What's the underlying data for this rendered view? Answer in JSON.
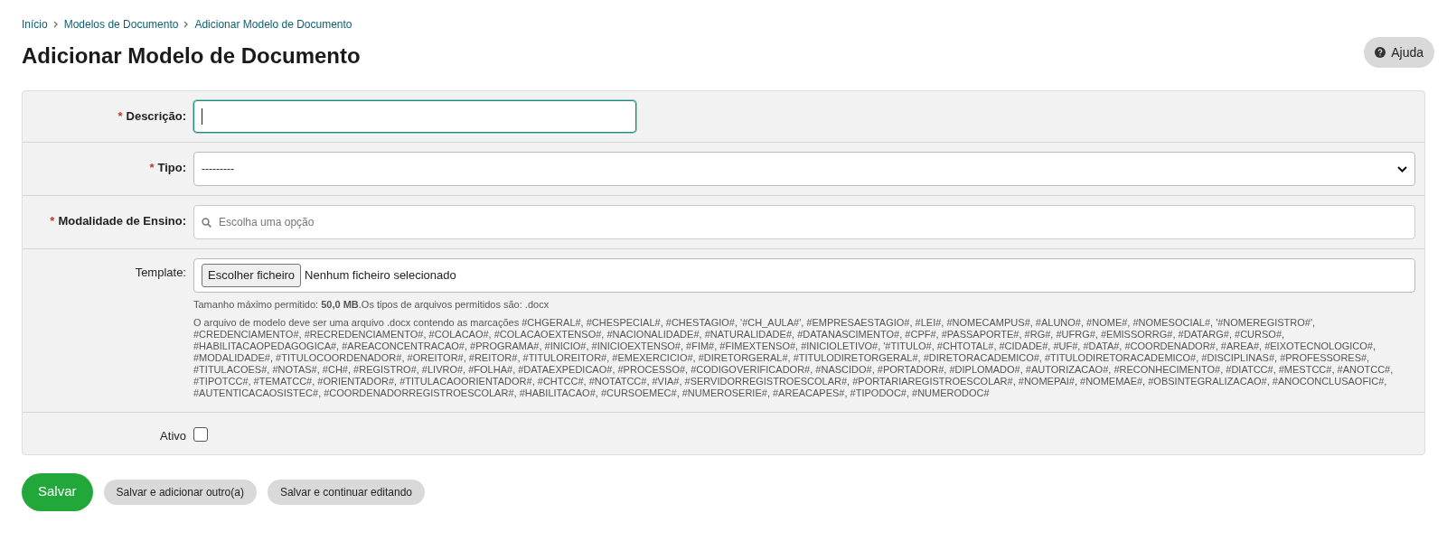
{
  "breadcrumbs": [
    {
      "label": "Início"
    },
    {
      "label": "Modelos de Documento"
    },
    {
      "label": "Adicionar Modelo de Documento"
    }
  ],
  "title": "Adicionar Modelo de Documento",
  "help_button": {
    "label": "Ajuda"
  },
  "fields": [
    {
      "kind": "text",
      "label": "Descrição:",
      "marker": "*",
      "focused": true
    },
    {
      "kind": "select",
      "label": "Tipo:",
      "marker": "*",
      "value": "---------"
    },
    {
      "kind": "autocomplete",
      "label": "Modalidade de Ensino:",
      "marker": "*",
      "placeholder": "Escolha uma opção"
    },
    {
      "kind": "file",
      "label": "Template:",
      "button": "Escolher ficheiro",
      "status": "Nenhum ficheiro selecionado",
      "help": [
        "Tamanho máximo permitido: **50,0 MB**.Os tipos de arquivos permitidos são: .docx",
        "O arquivo de modelo deve ser uma arquivo .docx contendo as marcações #CHGERAL#, #CHESPECIAL#, #CHESTAGIO#, '#CH_AULA#', #EMPRESAESTAGIO#, #LEI#, #NOMECAMPUS#, #ALUNO#, #NOME#, #NOMESOCIAL#, '#NOMEREGISTRO#', #CREDENCIAMENTO#, #RECREDENCIAMENTO#, #COLACAO#, #COLACAOEXTENSO#, #NACIONALIDADE#, #NATURALIDADE#, #DATANASCIMENTO#, #CPF#, #PASSAPORTE#, #RG#, #UFRG#, #EMISSORRG#, #DATARG#, #CURSO#, #HABILITACAOPEDAGOGICA#, #AREACONCENTRACAO#, #PROGRAMA#, #INICIO#, #INICIOEXTENSO#, #FIM#, #FIMEXTENSO#, #INICIOLETIVO#, '#TITULO#, #CHTOTAL#, #CIDADE#, #UF#, #DATA#, #COORDENADOR#, #AREA#, #EIXOTECNOLOGICO#, #MODALIDADE#, #TITULOCOORDENADOR#, #OREITOR#, #REITOR#, #TITULOREITOR#, #EMEXERCICIO#, #DIRETORGERAL#, #TITULODIRETORGERAL#, #DIRETORACADEMICO#, #TITULODIRETORACADEMICO#, #DISCIPLINAS#, #PROFESSORES#, #TITULACOES#, #NOTAS#, #CH#, #REGISTRO#, #LIVRO#, #FOLHA#, #DATAEXPEDICAO#, #PROCESSO#, #CODIGOVERIFICADOR#, #NASCIDO#, #PORTADOR#, #DIPLOMADO#, #AUTORIZACAO#, #RECONHECIMENTO#, #DIATCC#, #MESTCC#, #ANOTCC#, #TIPOTCC#, #TEMATCC#, #ORIENTADOR#, #TITULACAOORIENTADOR#, #CHTCC#, #NOTATCC#, #VIA#, #SERVIDORREGISTROESCOLAR#, #PORTARIAREGISTROESCOLAR#, #NOMEPAI#, #NOMEMAE#, #OBSINTEGRALIZACAO#, #ANOCONCLUSAOFIC#, #AUTENTICACAOSISTEC#, #COORDENADORREGISTROESCOLAR#, #HABILITACAO#, #CURSOEMEC#, #NUMEROSERIE#, #AREACAPES#, #TIPODOC#, #NUMERODOC#"
      ]
    },
    {
      "kind": "checkbox",
      "label": "Ativo",
      "checked": false
    }
  ],
  "actions": [
    {
      "kind": "primary",
      "label": "Salvar"
    },
    {
      "kind": "secondary",
      "label": "Salvar e adicionar outro(a)"
    },
    {
      "kind": "secondary",
      "label": "Salvar e continuar editando"
    }
  ]
}
